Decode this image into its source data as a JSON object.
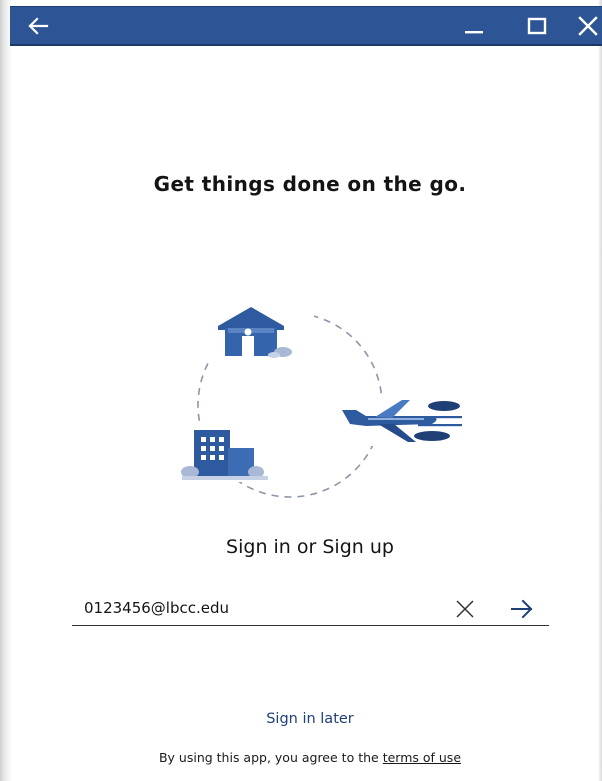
{
  "titlebar": {
    "back_icon": "arrow-left-icon",
    "minimize_icon": "minimize-icon",
    "maximize_icon": "maximize-icon",
    "close_icon": "close-icon",
    "color": "#2d5596"
  },
  "main": {
    "headline": "Get things done on the go.",
    "illustration_icons": [
      "house-icon",
      "office-building-icon",
      "airplane-icon",
      "cloud-icon"
    ],
    "signin_title": "Sign in or Sign up",
    "email_value": "0123456@lbcc.edu",
    "clear_icon": "close-icon",
    "submit_icon": "arrow-right-icon",
    "sign_in_later": "Sign in later",
    "terms_prefix": "By using this app, you agree to the ",
    "terms_link": "terms of use",
    "accent_color": "#2d5596"
  }
}
